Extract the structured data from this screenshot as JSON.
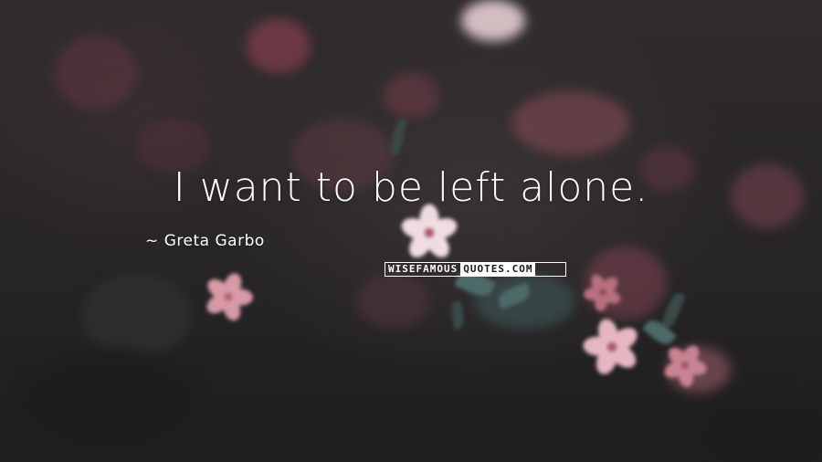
{
  "quote": {
    "text": "I want to be left alone."
  },
  "author": {
    "dash": "~",
    "name": "Greta Garbo"
  },
  "watermark": {
    "left": "WISEFAMOUS",
    "right": "QUOTES.COM"
  },
  "colors": {
    "text": "#ffffff",
    "background": "#2a2a2a",
    "petal_pink": "#d9a0ab",
    "petal_light": "#f1dde1",
    "leaf": "#4d6a68"
  }
}
